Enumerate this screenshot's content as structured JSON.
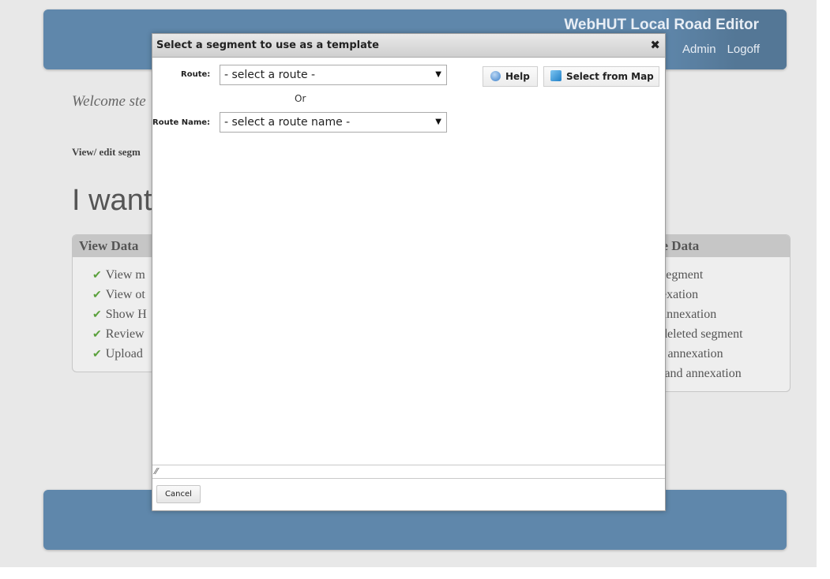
{
  "header": {
    "app_title": "WebHUT Local Road Editor",
    "links": [
      "Admin",
      "Logoff"
    ]
  },
  "main": {
    "welcome": "Welcome ste",
    "view_edit": "View/ edit segm",
    "heading": "I want"
  },
  "panels": {
    "left": {
      "title": "View Data",
      "items": [
        "View m",
        "View ot",
        "Show H",
        "Review",
        "Upload"
      ]
    },
    "right": {
      "title": "ve Data",
      "items": [
        "segment",
        "exation",
        "annexation",
        "deleted segment",
        "l annexation",
        "land annexation"
      ]
    }
  },
  "dialog": {
    "title": "Select a segment to use as a template",
    "close_icon": "close-icon",
    "route_label": "Route:",
    "route_value": "- select a route -",
    "or_text": "Or",
    "route_name_label": "Route Name:",
    "route_name_value": "- select a route name -",
    "help_label": "Help",
    "select_map_label": "Select from Map",
    "cancel_label": "Cancel"
  },
  "colors": {
    "header_bg": "#5f87ab",
    "page_bg": "#e8e8e8",
    "panel_head": "#c6c6c6",
    "check": "#5aa03c"
  }
}
